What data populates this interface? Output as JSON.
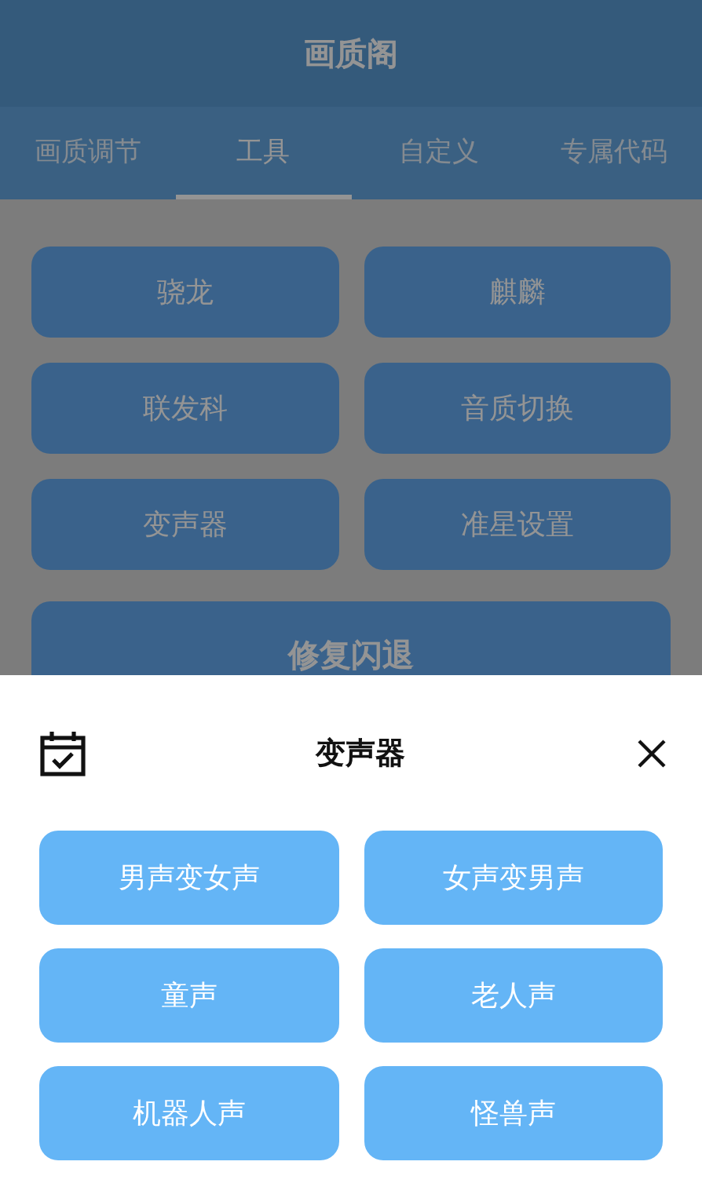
{
  "app_bar": {
    "title": "画质阁"
  },
  "tabs": [
    {
      "label": "画质调节",
      "selected": false
    },
    {
      "label": "工具",
      "selected": true
    },
    {
      "label": "自定义",
      "selected": false
    },
    {
      "label": "专属代码",
      "selected": false
    }
  ],
  "tools": [
    "骁龙",
    "麒麟",
    "联发科",
    "音质切换",
    "变声器",
    "准星设置"
  ],
  "wide_button": "修复闪退",
  "sheet": {
    "title": "变声器",
    "options": [
      "男声变女声",
      "女声变男声",
      "童声",
      "老人声",
      "机器人声",
      "怪兽声"
    ]
  }
}
